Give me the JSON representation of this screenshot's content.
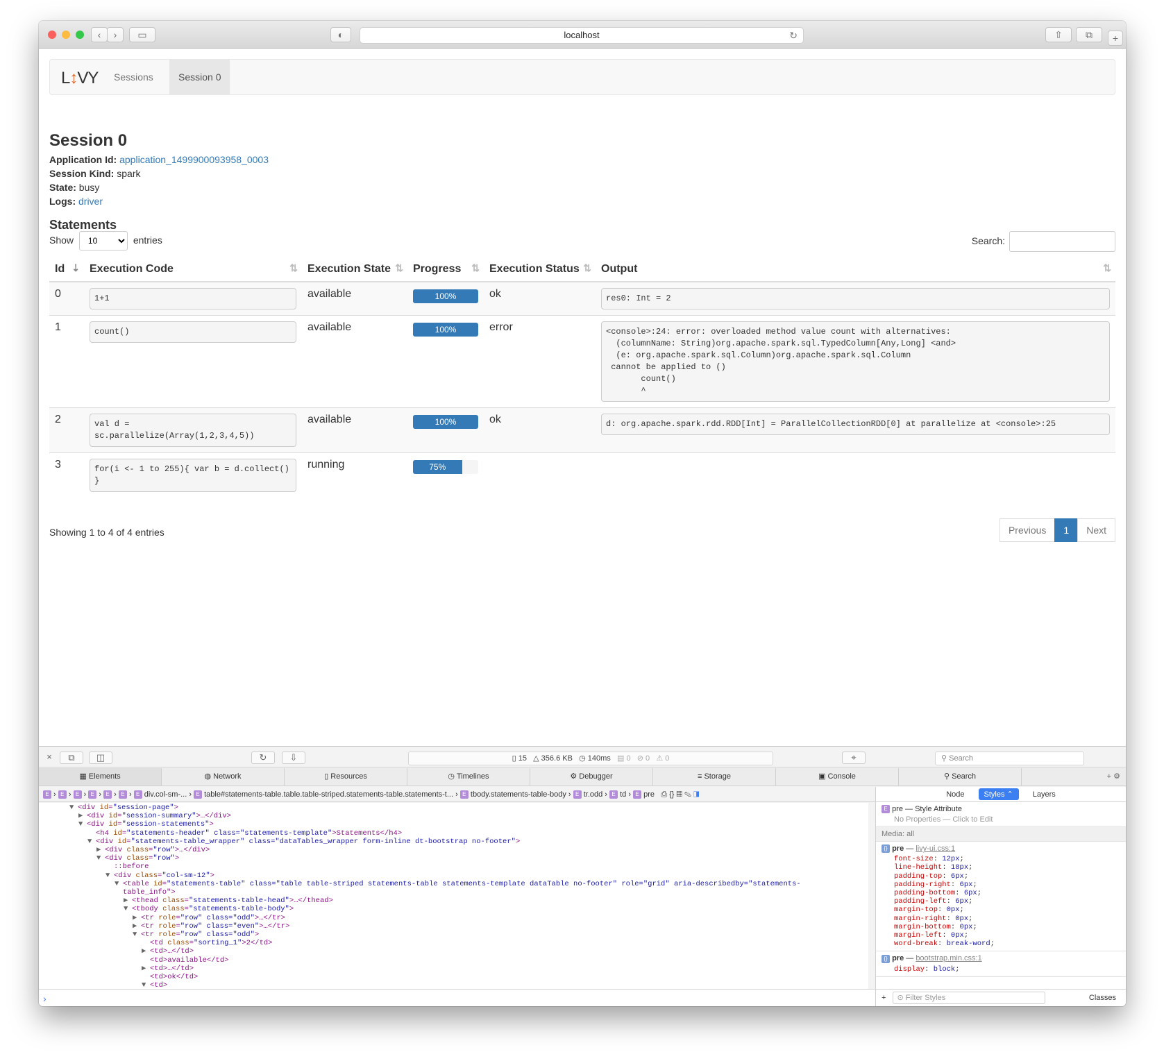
{
  "browser": {
    "url": "localhost"
  },
  "nav": {
    "logo_left": "L",
    "logo_arrow": "↕",
    "logo_right": "VY",
    "items": [
      "Sessions",
      "Session 0"
    ]
  },
  "session": {
    "title": "Session 0",
    "app_id_label": "Application Id:",
    "app_id": "application_1499900093958_0003",
    "kind_label": "Session Kind:",
    "kind": "spark",
    "state_label": "State:",
    "state": "busy",
    "logs_label": "Logs:",
    "logs": "driver"
  },
  "statements": {
    "header": "Statements",
    "show_label": "Show",
    "length_value": "10",
    "entries_label": "entries",
    "search_label": "Search:",
    "columns": [
      "Id",
      "Execution Code",
      "Execution State",
      "Progress",
      "Execution Status",
      "Output"
    ],
    "rows": [
      {
        "id": "0",
        "code": "1+1",
        "state": "available",
        "progress_label": "100%",
        "progress": 1.0,
        "status": "ok",
        "output": "res0: Int = 2"
      },
      {
        "id": "1",
        "code": "count()",
        "state": "available",
        "progress_label": "100%",
        "progress": 1.0,
        "status": "error",
        "output": "<console>:24: error: overloaded method value count with alternatives:\n  (columnName: String)org.apache.spark.sql.TypedColumn[Any,Long] <and>\n  (e: org.apache.spark.sql.Column)org.apache.spark.sql.Column\n cannot be applied to ()\n       count()\n       ^"
      },
      {
        "id": "2",
        "code": "val d = sc.parallelize(Array(1,2,3,4,5))",
        "state": "available",
        "progress_label": "100%",
        "progress": 1.0,
        "status": "ok",
        "output": "d: org.apache.spark.rdd.RDD[Int] = ParallelCollectionRDD[0] at parallelize at <console>:25"
      },
      {
        "id": "3",
        "code": "for(i <- 1 to 255){ var b = d.collect() }",
        "state": "running",
        "progress_label": "75%",
        "progress": 0.75,
        "status": "",
        "output": ""
      }
    ],
    "info": "Showing 1 to 4 of 4 entries",
    "pager": [
      "Previous",
      "1",
      "Next"
    ]
  },
  "devtools": {
    "stats": {
      "resources": "15",
      "size": "356.6 KB",
      "time": "140ms",
      "logs": "0",
      "errors": "0",
      "warnings": "0"
    },
    "search_placeholder": "Search",
    "tabs": [
      "Elements",
      "Network",
      "Resources",
      "Timelines",
      "Debugger",
      "Storage",
      "Console",
      "Search"
    ],
    "breadcrumbs": [
      "div.col-sm-...",
      "table#statements-table.table.table-striped.statements-table.statements-t...",
      "tbody.statements-table-body",
      "tr.odd",
      "td",
      "pre"
    ],
    "dom_lines": [
      [
        0,
        "▼",
        "<div ",
        "id",
        "\"session-page\"",
        ">"
      ],
      [
        1,
        "▶",
        "<div ",
        "id",
        "\"session-summary\"",
        ">…</div>"
      ],
      [
        1,
        "▼",
        "<div ",
        "id",
        "\"session-statements\"",
        ">"
      ],
      [
        2,
        "",
        "<h4 ",
        "id",
        "\"statements-header\" class=\"statements-template\"",
        ">Statements</h4>"
      ],
      [
        2,
        "▼",
        "<div ",
        "id",
        "\"statements-table_wrapper\" class=\"dataTables_wrapper form-inline dt-bootstrap no-footer\"",
        ">"
      ],
      [
        3,
        "▶",
        "<div ",
        "class",
        "\"row\"",
        ">…</div>"
      ],
      [
        3,
        "▼",
        "<div ",
        "class",
        "\"row\"",
        ">"
      ],
      [
        4,
        "",
        "::before",
        "",
        "",
        ""
      ],
      [
        4,
        "▼",
        "<div ",
        "class",
        "\"col-sm-12\"",
        ">"
      ],
      [
        5,
        "▼",
        "<table ",
        "id",
        "\"statements-table\" class=\"table table-striped statements-table statements-template dataTable no-footer\" role=\"grid\" aria-describedby=\"statements-",
        ""
      ],
      [
        5,
        "",
        "table_info\"",
        "",
        "",
        ">"
      ],
      [
        6,
        "▶",
        "<thead ",
        "class",
        "\"statements-table-head\"",
        ">…</thead>"
      ],
      [
        6,
        "▼",
        "<tbody ",
        "class",
        "\"statements-table-body\"",
        ">"
      ],
      [
        7,
        "▶",
        "<tr ",
        "role",
        "\"row\" class=\"odd\"",
        ">…</tr>"
      ],
      [
        7,
        "▶",
        "<tr ",
        "role",
        "\"row\" class=\"even\"",
        ">…</tr>"
      ],
      [
        7,
        "▼",
        "<tr ",
        "role",
        "\"row\" class=\"odd\"",
        ">"
      ],
      [
        8,
        "",
        "<td ",
        "class",
        "\"sorting_1\"",
        ">2</td>"
      ],
      [
        8,
        "▶",
        "<td>…</td>",
        "",
        "",
        ""
      ],
      [
        8,
        "",
        "<td>available</td>",
        "",
        "",
        ""
      ],
      [
        8,
        "▶",
        "<td>…</td>",
        "",
        "",
        ""
      ],
      [
        8,
        "",
        "<td>ok</td>",
        "",
        "",
        ""
      ],
      [
        8,
        "▼",
        "<td>",
        "",
        "",
        ""
      ]
    ],
    "sidebar": {
      "tabs": [
        "Node",
        "Styles ⌃",
        "Layers"
      ],
      "style_attr": "pre — Style Attribute",
      "no_props": "No Properties — Click to Edit",
      "media": "Media: all",
      "rule1_selector": "pre",
      "rule1_source": "livy-ui.css:1",
      "rule1_props": [
        [
          "font-size",
          "12px"
        ],
        [
          "line-height",
          "18px"
        ],
        [
          "padding-top",
          "6px"
        ],
        [
          "padding-right",
          "6px"
        ],
        [
          "padding-bottom",
          "6px"
        ],
        [
          "padding-left",
          "6px"
        ],
        [
          "margin-top",
          "0px"
        ],
        [
          "margin-right",
          "0px"
        ],
        [
          "margin-bottom",
          "0px"
        ],
        [
          "margin-left",
          "0px"
        ],
        [
          "word-break",
          "break-word"
        ]
      ],
      "rule2_selector": "pre",
      "rule2_source": "bootstrap.min.css:1",
      "rule2_props": [
        [
          "display",
          "block"
        ]
      ],
      "filter_placeholder": "Filter Styles",
      "classes_label": "Classes"
    }
  }
}
